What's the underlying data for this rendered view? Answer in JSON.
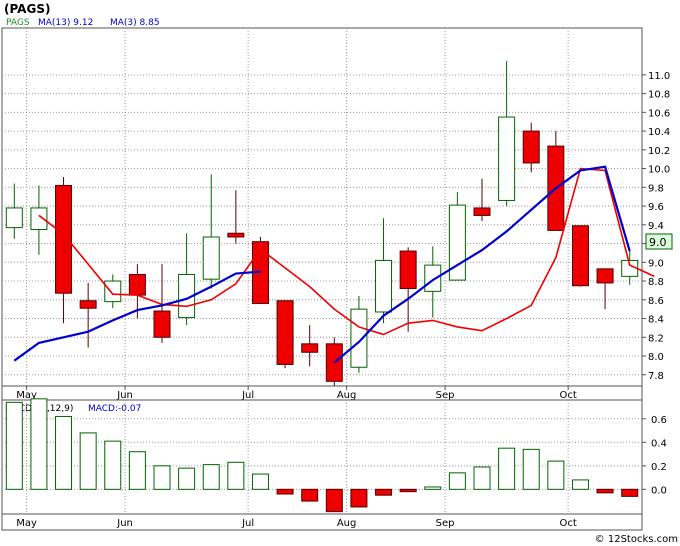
{
  "header": {
    "title": "(PAGS)",
    "legend": [
      {
        "text": "PAGS",
        "color": "#228b22"
      },
      {
        "text": "MA(13)  9.12",
        "color": "#0000cd"
      },
      {
        "text": "MA(3)  8.85",
        "color": "#0000cd"
      }
    ]
  },
  "macd_header": {
    "label": "MACD(26,12,9)",
    "value_label": "MACD:-0.07"
  },
  "current_price_label": "9.0",
  "watermark": "© 12Stocks.com",
  "colors": {
    "up_candle_outline": "#006400",
    "down_candle_fill": "#ee0000",
    "ma_short_color": "#ee0000",
    "ma_long_color": "#0000cd",
    "grid": "#999999",
    "macd_positive": "#006400",
    "macd_negative": "#ee0000",
    "price_badge_bg": "#ddffdd",
    "price_badge_border": "#006400"
  },
  "chart_data": [
    {
      "type": "candlestick",
      "title": "(PAGS)",
      "months": [
        {
          "label": "May",
          "week": 1
        },
        {
          "label": "Jun",
          "week": 5
        },
        {
          "label": "Jul",
          "week": 10
        },
        {
          "label": "Aug",
          "week": 14
        },
        {
          "label": "Sep",
          "week": 18
        },
        {
          "label": "Oct",
          "week": 23
        }
      ],
      "yticks": [
        "7.8",
        "8.0",
        "8.2",
        "8.4",
        "8.6",
        "8.8",
        "9.0",
        "9.2",
        "9.4",
        "9.6",
        "9.8",
        "10.0",
        "10.2",
        "10.4",
        "10.6",
        "10.8",
        "11.0"
      ],
      "ylim": [
        7.68,
        11.5
      ],
      "candles": [
        {
          "o": 9.37,
          "h": 9.84,
          "l": 9.25,
          "c": 9.58
        },
        {
          "o": 9.35,
          "h": 9.82,
          "l": 9.08,
          "c": 9.58
        },
        {
          "o": 9.82,
          "h": 9.91,
          "l": 8.35,
          "c": 8.67
        },
        {
          "o": 8.59,
          "h": 8.78,
          "l": 8.09,
          "c": 8.51
        },
        {
          "o": 8.58,
          "h": 8.87,
          "l": 8.51,
          "c": 8.8
        },
        {
          "o": 8.87,
          "h": 8.98,
          "l": 8.4,
          "c": 8.65
        },
        {
          "o": 8.48,
          "h": 8.98,
          "l": 8.14,
          "c": 8.2
        },
        {
          "o": 8.41,
          "h": 9.31,
          "l": 8.33,
          "c": 8.87
        },
        {
          "o": 8.82,
          "h": 9.94,
          "l": 8.72,
          "c": 9.27
        },
        {
          "o": 9.31,
          "h": 9.77,
          "l": 9.2,
          "c": 9.27
        },
        {
          "o": 9.22,
          "h": 9.27,
          "l": 8.56,
          "c": 8.56
        },
        {
          "o": 8.59,
          "h": 8.59,
          "l": 7.87,
          "c": 7.91
        },
        {
          "o": 8.13,
          "h": 8.33,
          "l": 7.89,
          "c": 8.04
        },
        {
          "o": 8.13,
          "h": 8.2,
          "l": 7.68,
          "c": 7.73
        },
        {
          "o": 7.88,
          "h": 8.64,
          "l": 7.82,
          "c": 8.5
        },
        {
          "o": 8.47,
          "h": 9.47,
          "l": 8.35,
          "c": 9.02
        },
        {
          "o": 9.12,
          "h": 9.16,
          "l": 8.26,
          "c": 8.72
        },
        {
          "o": 8.69,
          "h": 9.17,
          "l": 8.41,
          "c": 8.97
        },
        {
          "o": 8.81,
          "h": 9.75,
          "l": 8.81,
          "c": 9.61
        },
        {
          "o": 9.58,
          "h": 9.89,
          "l": 9.44,
          "c": 9.5
        },
        {
          "o": 9.66,
          "h": 11.15,
          "l": 9.6,
          "c": 10.55
        },
        {
          "o": 10.4,
          "h": 10.49,
          "l": 9.96,
          "c": 10.06
        },
        {
          "o": 10.24,
          "h": 10.4,
          "l": 9.34,
          "c": 9.34
        },
        {
          "o": 9.39,
          "h": 9.39,
          "l": 8.74,
          "c": 8.75
        },
        {
          "o": 8.93,
          "h": 8.93,
          "l": 8.5,
          "c": 8.78
        },
        {
          "o": 8.85,
          "h": 9.14,
          "l": 8.76,
          "c": 9.02
        }
      ],
      "series": [
        {
          "name": "MA(3)",
          "start_week": 1,
          "values": [
            9.5,
            9.3,
            8.98,
            8.66,
            8.65,
            8.55,
            8.53,
            8.6,
            8.77,
            9.14,
            8.94,
            8.74,
            8.5,
            8.31,
            8.23,
            8.35,
            8.38,
            8.31,
            8.27,
            8.4,
            8.54,
            9.05,
            10.0,
            9.98,
            8.97,
            8.85
          ]
        },
        {
          "name": "MA(13)",
          "start_week": 0,
          "values": [
            7.95,
            8.14,
            8.2,
            8.26,
            8.38,
            8.49,
            8.54,
            8.61,
            8.74,
            8.88,
            8.9
          ]
        },
        {
          "name": "MA(13)",
          "start_week": 13,
          "values": [
            7.93,
            8.15,
            8.43,
            8.61,
            8.81,
            8.97,
            9.13,
            9.33,
            9.56,
            9.79,
            9.98,
            10.02,
            9.12
          ]
        }
      ]
    },
    {
      "type": "bar",
      "title": "MACD(26,12,9)",
      "months": [
        {
          "label": "May",
          "week": 1
        },
        {
          "label": "Jun",
          "week": 5
        },
        {
          "label": "Jul",
          "week": 10
        },
        {
          "label": "Aug",
          "week": 14
        },
        {
          "label": "Sep",
          "week": 18
        },
        {
          "label": "Oct",
          "week": 23
        }
      ],
      "yticks": [
        "0.0",
        "0.2",
        "0.4",
        "0.6"
      ],
      "ylim": [
        -0.21,
        0.76
      ],
      "values": [
        0.74,
        0.77,
        0.62,
        0.48,
        0.41,
        0.32,
        0.2,
        0.18,
        0.21,
        0.23,
        0.13,
        -0.04,
        -0.1,
        -0.19,
        -0.15,
        -0.05,
        -0.02,
        0.02,
        0.14,
        0.19,
        0.35,
        0.34,
        0.24,
        0.08,
        -0.03,
        -0.06
      ]
    }
  ]
}
